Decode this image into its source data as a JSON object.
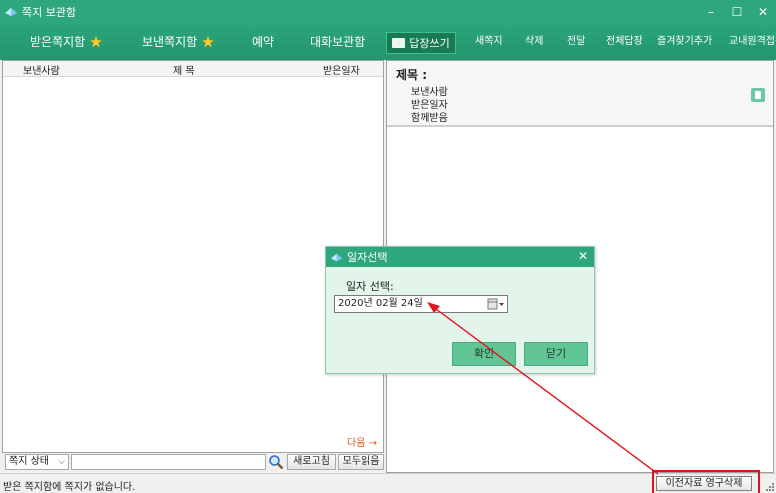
{
  "window": {
    "title": "쪽지 보관함",
    "controls": [
      "–",
      "☐",
      "✕"
    ]
  },
  "nav": {
    "received": "받은쪽지함",
    "sent": "보낸쪽지함",
    "reserved": "예약",
    "conversation": "대화보관함",
    "reply": "답장쓰기",
    "new": "새쪽지",
    "delete": "삭제",
    "forward": "전달",
    "reply_all": "전체답장",
    "add_favorite": "즐겨찾기추가",
    "teacher": "교내원격접속"
  },
  "list": {
    "col_sender": "보낸사람",
    "col_subject": "제 목",
    "col_date": "받은일자",
    "next": "다음 →"
  },
  "toolbar": {
    "status_select": "쪽지 상태",
    "refresh": "새로고침",
    "read_all": "모두읽음"
  },
  "detail": {
    "subject_label": "제목 :",
    "sender_label": "보낸사람",
    "date_label": "받은일자",
    "cc_label": "함께받음"
  },
  "status": {
    "message": "받은 쪽지함에 쪽지가 없습니다.",
    "purge_button": "이전자료 영구삭제"
  },
  "dialog": {
    "title": "일자선택",
    "field_label": "일자 선택:",
    "date_value": "2020년 02월 24일",
    "ok": "확인",
    "close": "닫기"
  },
  "colors": {
    "accent": "#2fa77d",
    "annotation": "#e0121a"
  }
}
